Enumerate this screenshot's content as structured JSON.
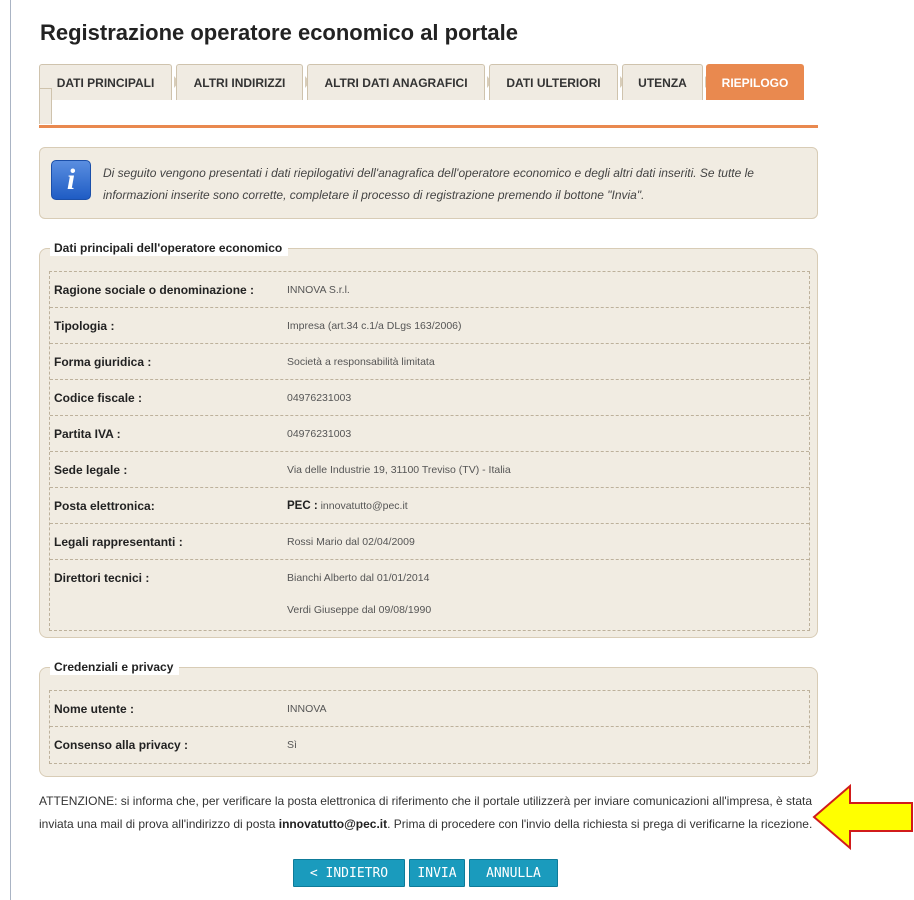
{
  "page": {
    "title": "Registrazione operatore economico al portale"
  },
  "tabs": [
    {
      "label": "DATI PRINCIPALI",
      "active": false
    },
    {
      "label": "ALTRI INDIRIZZI",
      "active": false
    },
    {
      "label": "ALTRI DATI ANAGRAFICI",
      "active": false
    },
    {
      "label": "DATI ULTERIORI",
      "active": false
    },
    {
      "label": "UTENZA",
      "active": false
    },
    {
      "label": "RIEPILOGO",
      "active": true
    }
  ],
  "info": {
    "icon": "info-icon",
    "text": "Di seguito vengono presentati i dati riepilogativi dell'anagrafica dell'operatore economico e degli altri dati inseriti. Se tutte le informazioni inserite sono corrette, completare il processo di registrazione premendo il bottone \"Invia\"."
  },
  "dati_principali": {
    "legend": "Dati principali dell'operatore economico",
    "rows": [
      {
        "label": "Ragione sociale o denominazione :",
        "value": "INNOVA S.r.l."
      },
      {
        "label": "Tipologia :",
        "value": "Impresa (art.34 c.1/a DLgs 163/2006)"
      },
      {
        "label": "Forma giuridica :",
        "value": "Società a responsabilità limitata"
      },
      {
        "label": "Codice fiscale :",
        "value": "04976231003"
      },
      {
        "label": "Partita IVA :",
        "value": "04976231003"
      },
      {
        "label": "Sede legale :",
        "value": "Via delle Industrie 19, 31100 Treviso (TV) - Italia"
      },
      {
        "label": "Posta elettronica:",
        "value_prefix": "PEC :",
        "value": "innovatutto@pec.it"
      },
      {
        "label": "Legali rappresentanti :",
        "value": "Rossi Mario dal 02/04/2009"
      },
      {
        "label": "Direttori tecnici :",
        "value": "Bianchi Alberto dal 01/01/2014",
        "value2": "Verdi Giuseppe dal 09/08/1990"
      }
    ]
  },
  "credenziali": {
    "legend": "Credenziali e privacy",
    "rows": [
      {
        "label": "Nome utente :",
        "value": "INNOVA"
      },
      {
        "label": "Consenso alla privacy :",
        "value": "Sì"
      }
    ]
  },
  "warning": {
    "part1": "ATTENZIONE: si informa che, per verificare la posta elettronica di riferimento che il portale utilizzerà per inviare comunicazioni all'impresa, è stata inviata una mail di prova all'indirizzo di posta ",
    "email": "innovatutto@pec.it",
    "part2": ". Prima di procedere con l'invio della richiesta si prega di verificarne la ricezione."
  },
  "buttons": {
    "back": "< INDIETRO",
    "send": "INVIA",
    "cancel": "ANNULLA"
  },
  "colors": {
    "accent": "#e9894f",
    "button": "#1a9bbd",
    "arrow_fill": "#ffff00",
    "arrow_stroke": "#d11b1b"
  }
}
